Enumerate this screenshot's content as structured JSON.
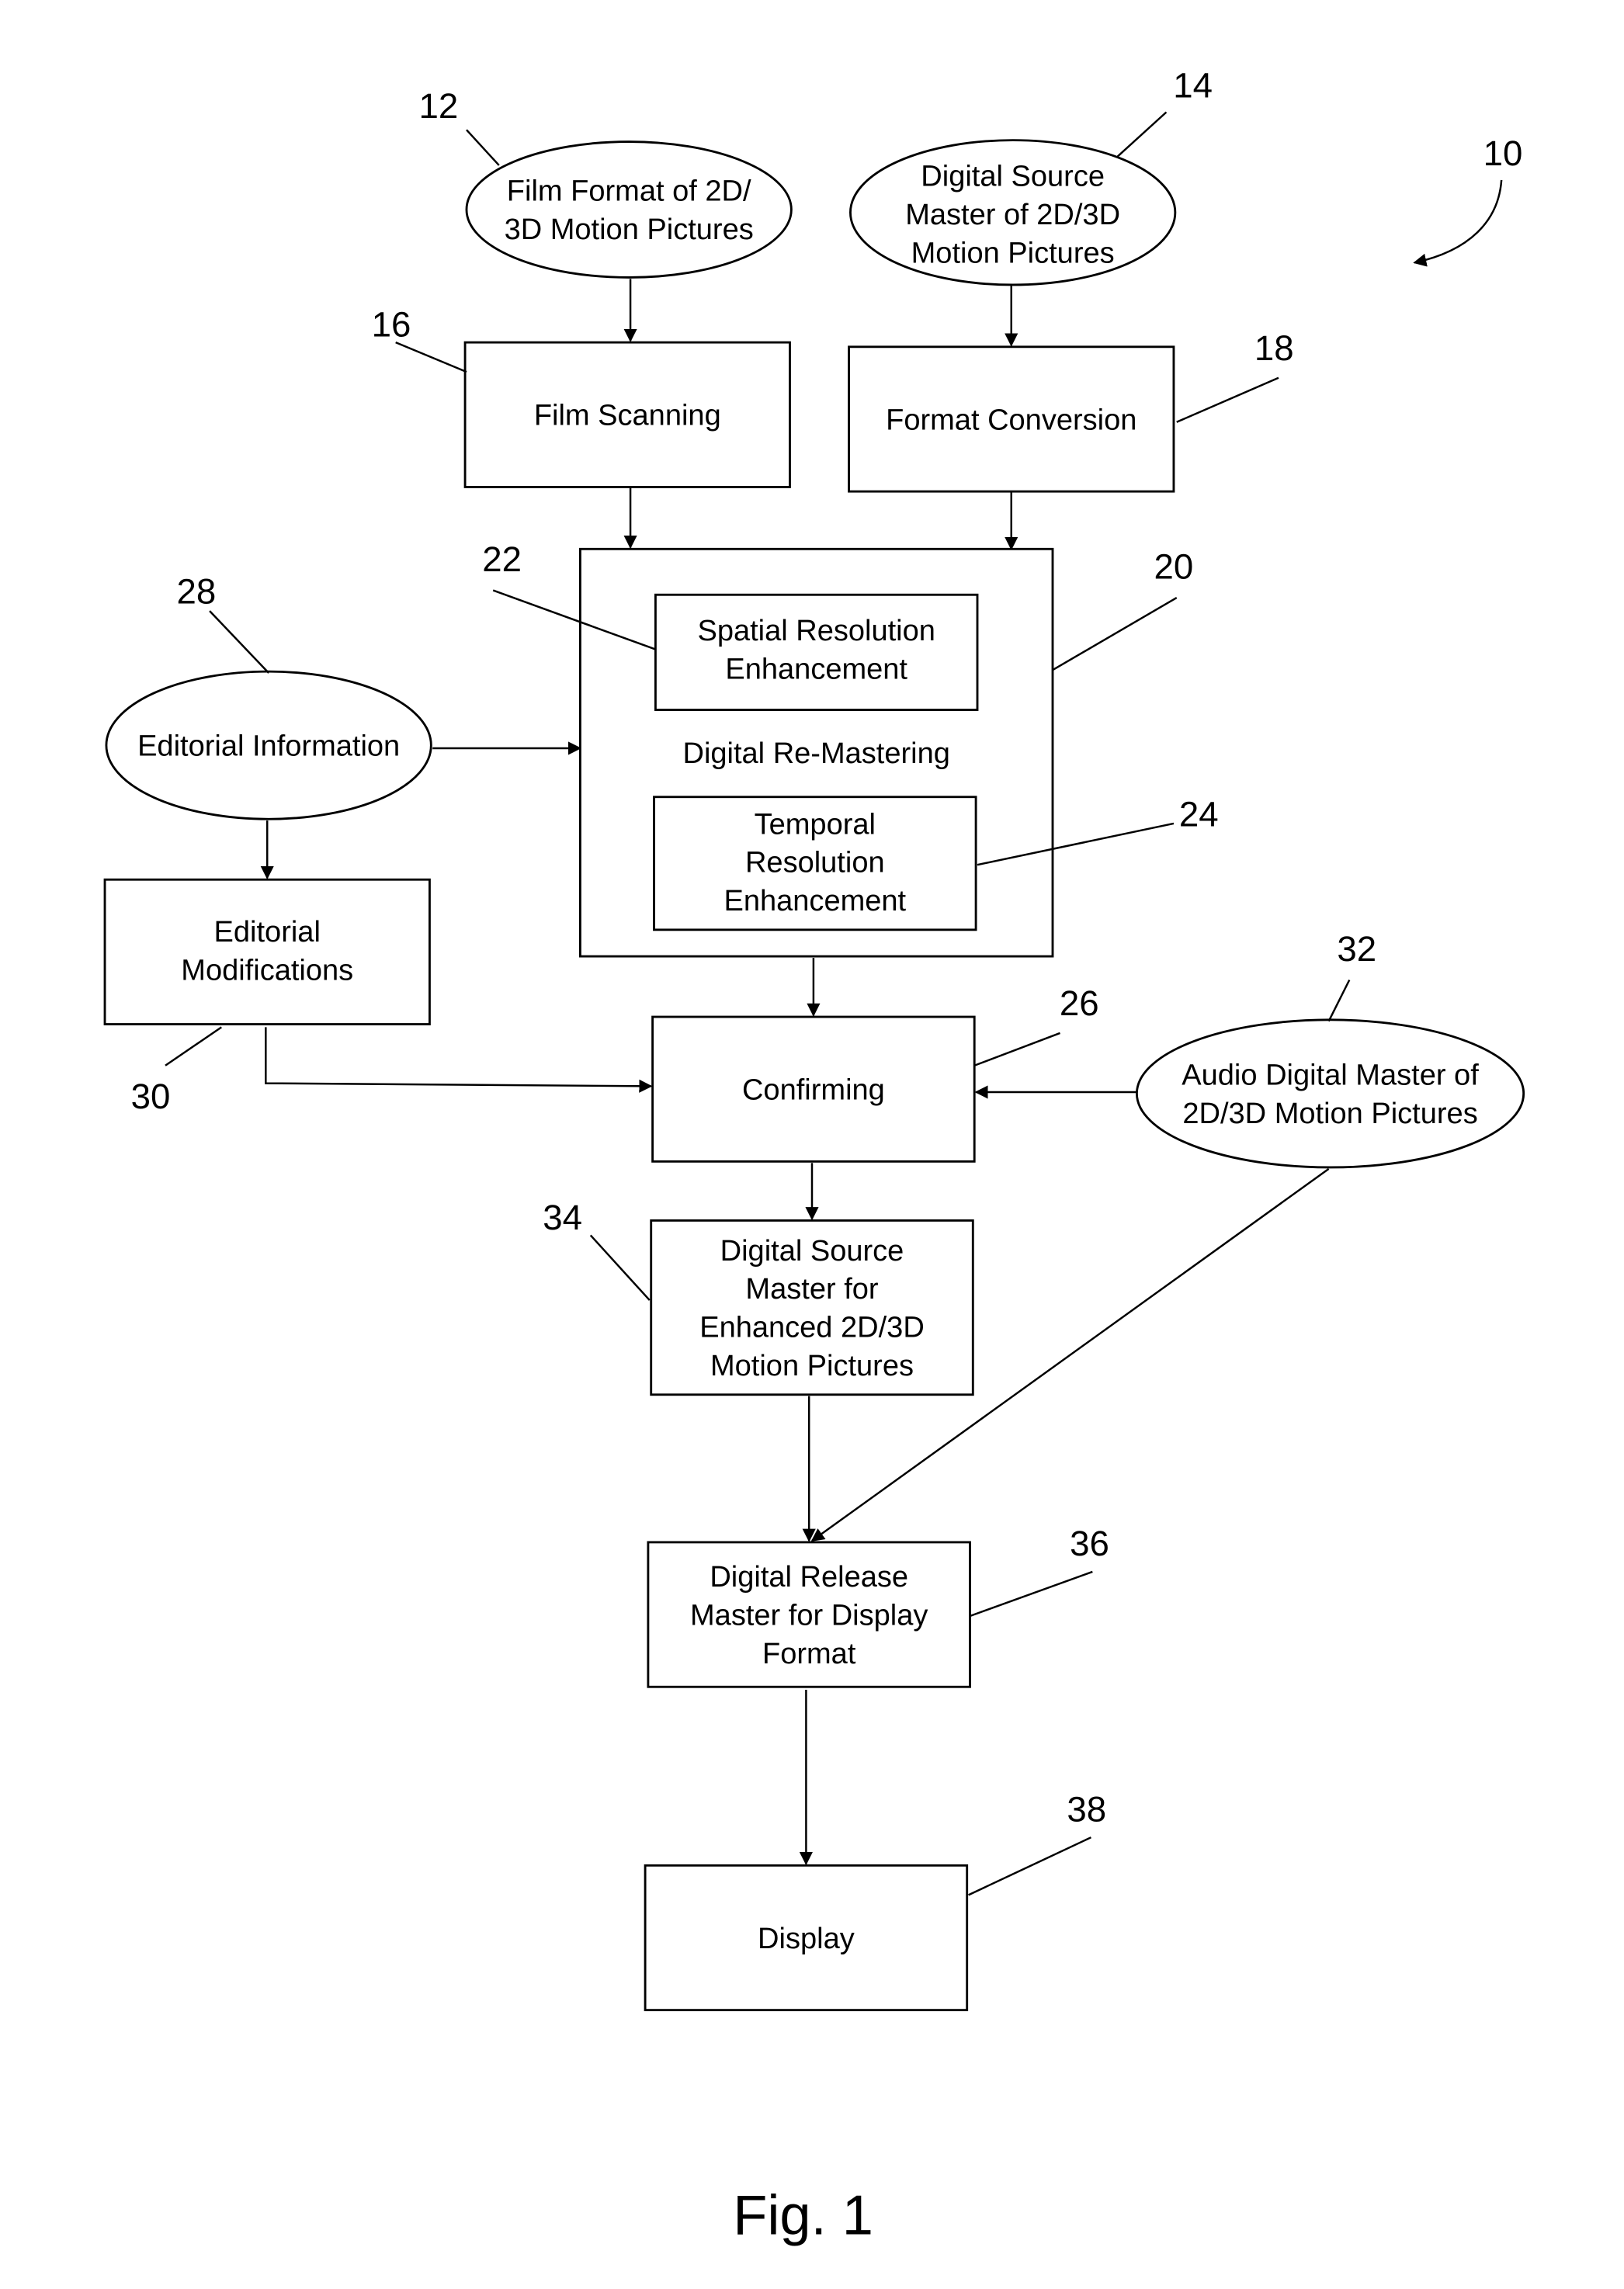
{
  "figure": {
    "caption": "Fig. 1",
    "system_ref": "10"
  },
  "nodes": [
    {
      "id": "n12",
      "ref": "12",
      "shape": "ellipse",
      "lines": [
        "Film Format of 2D/",
        "3D Motion Pictures"
      ]
    },
    {
      "id": "n14",
      "ref": "14",
      "shape": "ellipse",
      "lines": [
        "Digital Source",
        "Master of 2D/3D",
        "Motion Pictures"
      ]
    },
    {
      "id": "n16",
      "ref": "16",
      "shape": "box",
      "lines": [
        "Film Scanning"
      ]
    },
    {
      "id": "n18",
      "ref": "18",
      "shape": "box",
      "lines": [
        "Format Conversion"
      ]
    },
    {
      "id": "n20",
      "ref": "20",
      "shape": "box",
      "lines": [
        "Digital Re-Mastering"
      ]
    },
    {
      "id": "n22",
      "ref": "22",
      "shape": "box",
      "lines": [
        "Spatial Resolution",
        "Enhancement"
      ]
    },
    {
      "id": "n24",
      "ref": "24",
      "shape": "box",
      "lines": [
        "Temporal",
        "Resolution",
        "Enhancement"
      ]
    },
    {
      "id": "n28",
      "ref": "28",
      "shape": "ellipse",
      "lines": [
        "Editorial Information"
      ]
    },
    {
      "id": "n30",
      "ref": "30",
      "shape": "box",
      "lines": [
        "Editorial",
        "Modifications"
      ]
    },
    {
      "id": "n26",
      "ref": "26",
      "shape": "box",
      "lines": [
        "Confirming"
      ]
    },
    {
      "id": "n32",
      "ref": "32",
      "shape": "ellipse",
      "lines": [
        "Audio Digital Master of",
        "2D/3D Motion Pictures"
      ]
    },
    {
      "id": "n34",
      "ref": "34",
      "shape": "box",
      "lines": [
        "Digital Source",
        "Master for",
        "Enhanced 2D/3D",
        "Motion Pictures"
      ]
    },
    {
      "id": "n36",
      "ref": "36",
      "shape": "box",
      "lines": [
        "Digital Release",
        "Master for Display",
        "Format"
      ]
    },
    {
      "id": "n38",
      "ref": "38",
      "shape": "box",
      "lines": [
        "Display"
      ]
    }
  ],
  "edges": [
    {
      "from": "n12",
      "to": "n16"
    },
    {
      "from": "n14",
      "to": "n18"
    },
    {
      "from": "n16",
      "to": "n20"
    },
    {
      "from": "n18",
      "to": "n20"
    },
    {
      "from": "n28",
      "to": "n20"
    },
    {
      "from": "n28",
      "to": "n30"
    },
    {
      "from": "n20",
      "to": "n26"
    },
    {
      "from": "n30",
      "to": "n26"
    },
    {
      "from": "n32",
      "to": "n26"
    },
    {
      "from": "n26",
      "to": "n34"
    },
    {
      "from": "n34",
      "to": "n36"
    },
    {
      "from": "n32",
      "to": "n36"
    },
    {
      "from": "n36",
      "to": "n38"
    }
  ]
}
